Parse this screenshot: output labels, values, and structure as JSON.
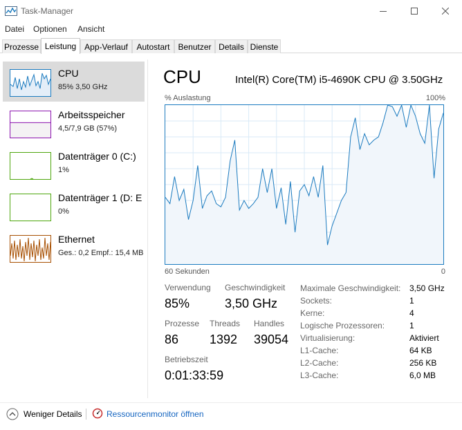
{
  "window": {
    "title": "Task-Manager"
  },
  "menu": [
    "Datei",
    "Optionen",
    "Ansicht"
  ],
  "tabs": [
    "Prozesse",
    "Leistung",
    "App-Verlauf",
    "Autostart",
    "Benutzer",
    "Details",
    "Dienste"
  ],
  "active_tab": "Leistung",
  "sidebar": [
    {
      "name": "CPU",
      "sub": "85% 3,50 GHz",
      "color": "#1a7abf"
    },
    {
      "name": "Arbeitsspeicher",
      "sub": "4,5/7,9 GB (57%)",
      "color": "#8b12ae"
    },
    {
      "name": "Datenträger 0 (C:)",
      "sub": "1%",
      "color": "#4da60c"
    },
    {
      "name": "Datenträger 1 (D: E",
      "sub": "0%",
      "color": "#4da60c"
    },
    {
      "name": "Ethernet",
      "sub": "Ges.: 0,2 Empf.: 15,4 MB",
      "color": "#a74f01"
    }
  ],
  "memory_usage_fraction": 0.57,
  "cpu": {
    "title": "CPU",
    "model": "Intel(R) Core(TM) i5-4690K CPU @ 3.50GHz",
    "graph": {
      "y_label": "% Auslastung",
      "y_max_label": "100%",
      "x_left_label": "60 Sekunden",
      "x_right_label": "0",
      "line_color": "#1a7abf",
      "fill_color": "#f1f6fb",
      "grid_color": "#d9eaf7"
    },
    "stats": {
      "usage_label": "Verwendung",
      "usage_value": "85%",
      "speed_label": "Geschwindigkeit",
      "speed_value": "3,50 GHz",
      "processes_label": "Prozesse",
      "processes_value": "86",
      "threads_label": "Threads",
      "threads_value": "1392",
      "handles_label": "Handles",
      "handles_value": "39054",
      "uptime_label": "Betriebszeit",
      "uptime_value": "0:01:33:59"
    },
    "details": [
      {
        "label": "Maximale Geschwindigkeit:",
        "value": "3,50 GHz"
      },
      {
        "label": "Sockets:",
        "value": "1"
      },
      {
        "label": "Kerne:",
        "value": "4"
      },
      {
        "label": "Logische Prozessoren:",
        "value": "1"
      },
      {
        "label": "Virtualisierung:",
        "value": "Aktiviert"
      },
      {
        "label": "L1-Cache:",
        "value": "64 KB"
      },
      {
        "label": "L2-Cache:",
        "value": "256 KB"
      },
      {
        "label": "L3-Cache:",
        "value": "6,0 MB"
      }
    ]
  },
  "chart_data": {
    "type": "area",
    "ylim": [
      0,
      100
    ],
    "xlim": [
      60,
      0
    ],
    "xlabel": "60 Sekunden",
    "ylabel": "% Auslastung",
    "x": [
      60,
      59,
      58,
      57,
      56,
      55,
      54,
      53,
      52,
      51,
      50,
      49,
      48,
      47,
      46,
      45,
      44,
      43,
      42,
      41,
      40,
      39,
      38,
      37,
      36,
      35,
      34,
      33,
      32,
      31,
      30,
      29,
      28,
      27,
      26,
      25,
      24,
      23,
      22,
      21,
      20,
      19,
      18,
      17,
      16,
      15,
      14,
      13,
      12,
      11,
      10,
      9,
      8,
      7,
      6,
      5,
      4,
      3,
      2,
      1,
      0
    ],
    "values": [
      42,
      38,
      55,
      40,
      47,
      28,
      40,
      62,
      35,
      43,
      46,
      38,
      36,
      42,
      65,
      78,
      34,
      40,
      35,
      38,
      42,
      60,
      45,
      60,
      35,
      48,
      25,
      52,
      20,
      46,
      50,
      43,
      55,
      42,
      62,
      12,
      24,
      32,
      40,
      45,
      80,
      92,
      72,
      82,
      75,
      78,
      80,
      89,
      100,
      99,
      93,
      100,
      86,
      100,
      93,
      82,
      76,
      100,
      54,
      85,
      95
    ]
  }
}
